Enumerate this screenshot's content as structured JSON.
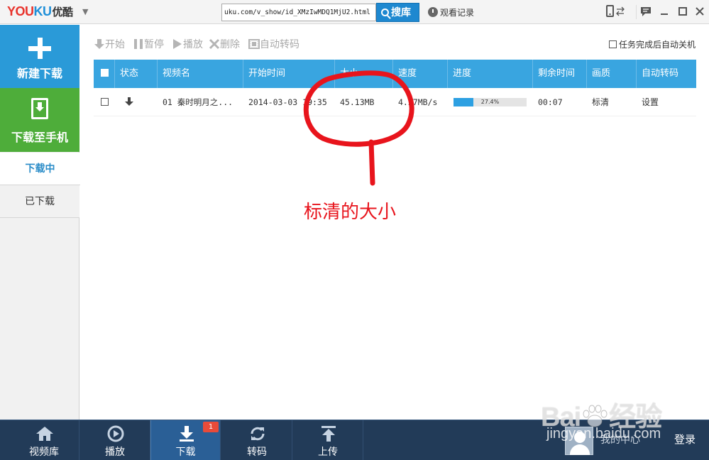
{
  "app": {
    "logo_you": "YOU",
    "logo_ku": "KU",
    "logo_cn": "优酷"
  },
  "titlebar": {
    "url_value": "uku.com/v_show/id_XMzIwMDQ1MjU2.html",
    "search_label": "搜库",
    "history_label": "观看记录"
  },
  "sidebar": {
    "new_download": "新建下载",
    "download_to_phone": "下载至手机",
    "tabs": [
      {
        "label": "下载中"
      },
      {
        "label": "已下载"
      }
    ]
  },
  "toolbar": {
    "start": "开始",
    "pause": "暂停",
    "play": "播放",
    "delete": "删除",
    "convert": "自动转码",
    "auto_shutdown": "任务完成后自动关机"
  },
  "table": {
    "columns": [
      "状态",
      "视频名",
      "开始时间",
      "大小",
      "速度",
      "进度",
      "剩余时间",
      "画质",
      "自动转码"
    ],
    "rows": [
      {
        "name": "01 秦时明月之...",
        "start_time": "2014-03-03 19:35",
        "size": "45.13MB",
        "speed": "4.27MB/s",
        "progress": 0.274,
        "progress_text": "27.4%",
        "remaining": "00:07",
        "quality": "标清",
        "convert": "设置"
      }
    ]
  },
  "annotation": {
    "text": "标清的大小",
    "color": "#e8141c"
  },
  "bottom_nav": {
    "items": [
      {
        "label": "视频库",
        "icon": "home-icon"
      },
      {
        "label": "播放",
        "icon": "play-circle-icon"
      },
      {
        "label": "下载",
        "icon": "download-icon",
        "badge": "1"
      },
      {
        "label": "转码",
        "icon": "refresh-icon"
      },
      {
        "label": "上传",
        "icon": "upload-icon"
      }
    ],
    "user_name": "我的中心",
    "login": "登录"
  },
  "watermark": {
    "main": "Bai",
    "main_end": "经验",
    "sub": "jingyan.baidu.com"
  },
  "colors": {
    "accent_blue": "#2a9ad8",
    "green": "#4ead3a",
    "bottom_bar": "#223b58"
  }
}
